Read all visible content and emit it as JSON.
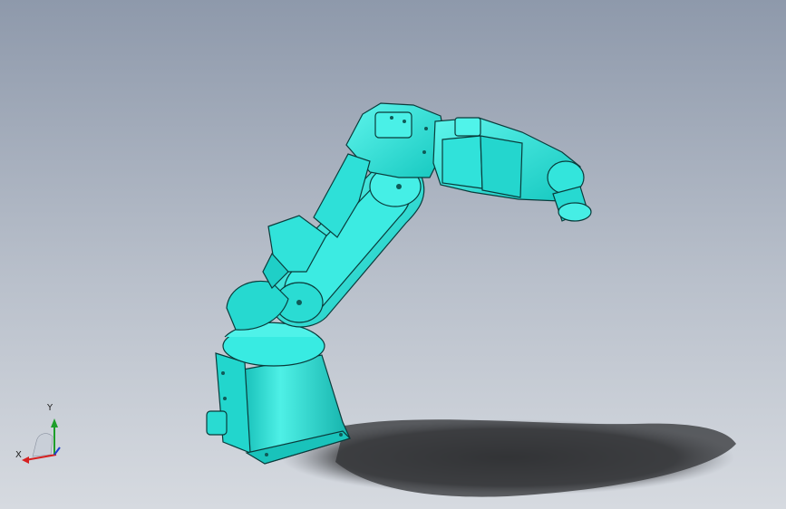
{
  "viewport": {
    "background_top": "#8e99ab",
    "background_bottom": "#d6dae0"
  },
  "model": {
    "part_color": "#2fe3d9",
    "edge_color": "#0a3b3b",
    "shadow_color": "#3a3b3d"
  },
  "triad": {
    "x_label": "X",
    "y_label": "Y",
    "x_color": "#d62020",
    "y_color": "#1e9e2a",
    "z_color": "#2040d0"
  }
}
